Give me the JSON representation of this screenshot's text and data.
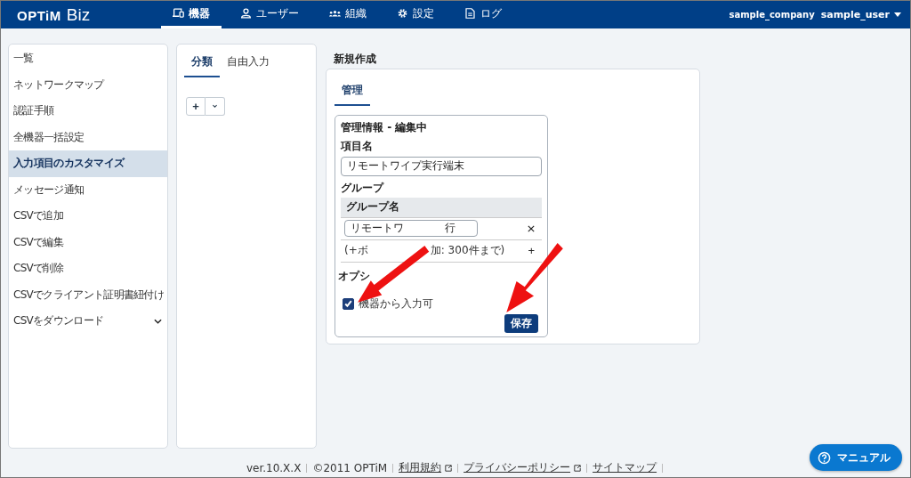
{
  "header": {
    "logo": {
      "brand": "OPTiM",
      "product": "Biz"
    },
    "nav": [
      {
        "label": "機器",
        "selected": true
      },
      {
        "label": "ユーザー",
        "selected": false
      },
      {
        "label": "組織",
        "selected": false
      },
      {
        "label": "設定",
        "selected": false
      },
      {
        "label": "ログ",
        "selected": false
      }
    ],
    "company": "sample_company",
    "user": "sample_user"
  },
  "sidebar": {
    "items": [
      {
        "label": "一覧",
        "selected": false,
        "has_submenu": false
      },
      {
        "label": "ネットワークマップ",
        "selected": false,
        "has_submenu": false
      },
      {
        "label": "認証手順",
        "selected": false,
        "has_submenu": false
      },
      {
        "label": "全機器一括設定",
        "selected": false,
        "has_submenu": false
      },
      {
        "label": "入力項目のカスタマイズ",
        "selected": true,
        "has_submenu": false
      },
      {
        "label": "メッセージ通知",
        "selected": false,
        "has_submenu": false
      },
      {
        "label": "CSVで追加",
        "selected": false,
        "has_submenu": false
      },
      {
        "label": "CSVで編集",
        "selected": false,
        "has_submenu": false
      },
      {
        "label": "CSVで削除",
        "selected": false,
        "has_submenu": false
      },
      {
        "label": "CSVでクライアント証明書紐付け",
        "selected": false,
        "has_submenu": false
      },
      {
        "label": "CSVをダウンロード",
        "selected": false,
        "has_submenu": true
      }
    ]
  },
  "list_panel": {
    "tabs": [
      {
        "label": "分類",
        "selected": true
      },
      {
        "label": "自由入力",
        "selected": false
      }
    ],
    "add_button": "+"
  },
  "editor": {
    "title": "新規作成",
    "tabs": [
      {
        "label": "管理",
        "selected": true
      }
    ],
    "form": {
      "title": "管理情報 - 編集中",
      "name_label": "項目名",
      "name_value": "リモートワイプ実行端末",
      "group_label": "グループ",
      "group_header": "グループ名",
      "groups": [
        {
          "value_start": "リモートワ",
          "value_end": "行"
        }
      ],
      "add_hint_start": "(+ボ",
      "add_hint_end": "加: 300件まで)",
      "add_button": "+",
      "option_label": "オプシ",
      "option": {
        "label": "機器から入力可",
        "checked": true
      },
      "save": "保存"
    }
  },
  "footer": [
    {
      "text": "ver.10.X.X",
      "link": false
    },
    {
      "text": "©2011 OPTiM",
      "link": false
    },
    {
      "text": "利用規約",
      "link": true
    },
    {
      "text": "プライバシーポリシー",
      "link": true
    },
    {
      "text": "サイトマップ",
      "link": true
    }
  ],
  "manual_button": "マニュアル"
}
